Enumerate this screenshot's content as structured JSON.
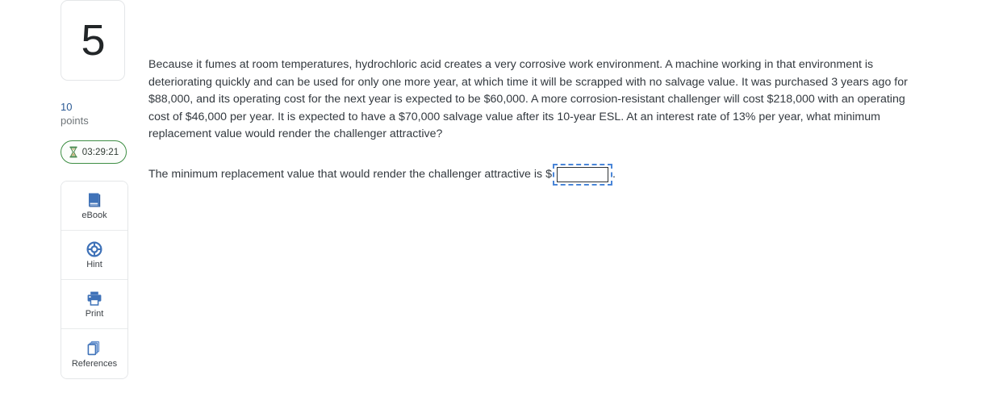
{
  "question": {
    "number": "5",
    "points_value": "10",
    "points_label": "points",
    "timer": "03:29:21",
    "timer_icon": "hourglass-icon",
    "body": "Because it fumes at room temperatures, hydrochloric acid creates a very corrosive work environment. A machine working in that environment is deteriorating quickly and can be used for only one more year, at which time it will be scrapped with no salvage value. It was purchased 3 years ago for $88,000, and its operating cost for the next year is expected to be $60,000. A more corrosion-resistant challenger will cost $218,000 with an operating cost of $46,000 per year. It is expected to have a $70,000 salvage value after its 10-year ESL. At an interest rate of 13% per year, what minimum replacement value would render the challenger attractive?"
  },
  "answer": {
    "prompt": "The minimum replacement value that would render the challenger attractive is",
    "currency_symbol": "$",
    "input_value": "",
    "input_placeholder": "",
    "trailing_punctuation": "."
  },
  "tools": [
    {
      "label": "eBook",
      "icon": "book-icon"
    },
    {
      "label": "Hint",
      "icon": "life-ring-icon"
    },
    {
      "label": "Print",
      "icon": "printer-icon"
    },
    {
      "label": "References",
      "icon": "stacked-pages-icon"
    }
  ],
  "colors": {
    "icon_blue": "#3f72b8",
    "points_blue": "#2b5a94",
    "timer_green": "#3f8f45",
    "text": "#33393f",
    "border_gray": "#e4e6e8",
    "focus_blue": "#4a86d8"
  }
}
